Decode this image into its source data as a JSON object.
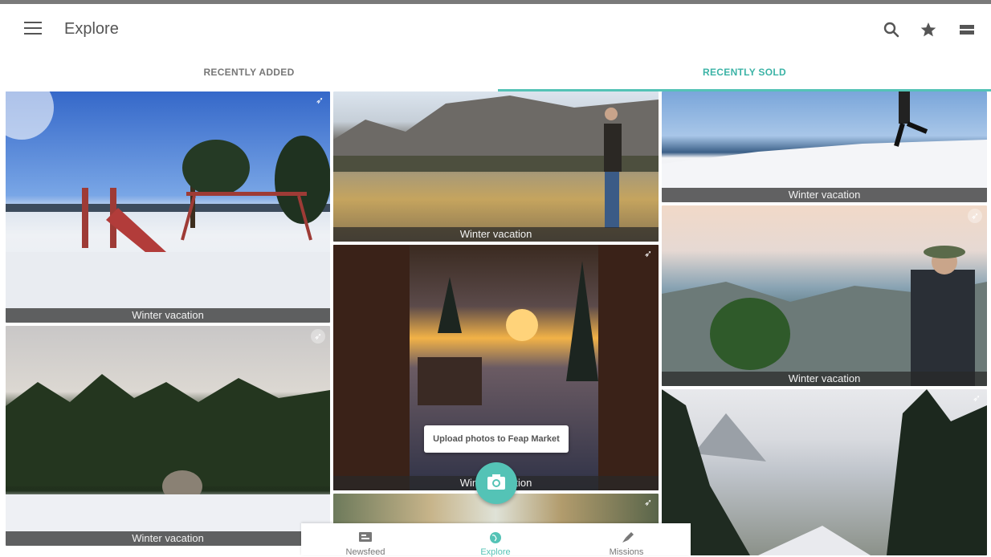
{
  "app": {
    "title": "Explore",
    "accent_color": "#54c3b6",
    "actions": [
      {
        "icon": "search-icon"
      },
      {
        "icon": "star-icon"
      },
      {
        "icon": "view-list-icon"
      }
    ]
  },
  "tabs": [
    {
      "label": "RECENTLY ADDED",
      "active": false
    },
    {
      "label": "RECENTLY SOLD",
      "active": true
    }
  ],
  "tiles": [
    {
      "caption": "Winter vacation",
      "scene": "snowy playground with swings and slide"
    },
    {
      "caption": "Winter vacation",
      "scene": "snowy pine forest with woman sitting in snow"
    },
    {
      "caption": "Winter vacation",
      "scene": "man standing by mountain lake"
    },
    {
      "caption": "Winter vacation",
      "scene": "sunset through window with skis"
    },
    {
      "caption": "",
      "scene": "forest trees"
    },
    {
      "caption": "Winter vacation",
      "scene": "person jumping on snow"
    },
    {
      "caption": "Winter vacation",
      "scene": "hiker with backpack at canyon"
    },
    {
      "caption": "",
      "scene": "snowy mountain road with pine trees"
    }
  ],
  "tooltip": "Upload photos to Feap Market",
  "fab_icon": "camera-icon",
  "bottom_nav": [
    {
      "label": "Newsfeed",
      "icon": "newsfeed-icon",
      "active": false
    },
    {
      "label": "Explore",
      "icon": "globe-icon",
      "active": true
    },
    {
      "label": "Missions",
      "icon": "rocket-icon",
      "active": false
    }
  ]
}
